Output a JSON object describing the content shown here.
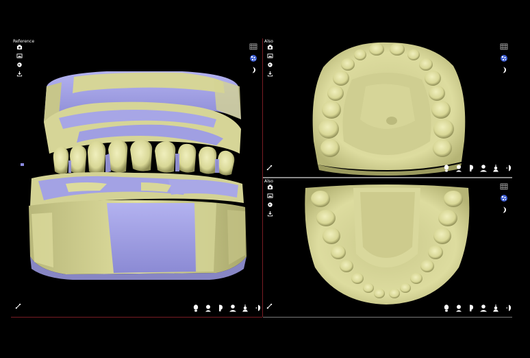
{
  "viewports": {
    "main": {
      "label": "Reference"
    },
    "upper": {
      "label": "Also"
    },
    "lower": {
      "label": "Also"
    }
  },
  "icons": {
    "left_toolbar": [
      "camera-icon",
      "image-icon",
      "globe-icon",
      "download-icon"
    ],
    "right_toolbar": [
      "grid-icon",
      "texture-icon",
      "jaw-icon"
    ],
    "view_bar": [
      "face-front-view-icon",
      "face-left-view-icon",
      "face-right-view-icon",
      "face-back-view-icon",
      "face-bottom-view-icon",
      "face-side-view-icon"
    ],
    "corner": "measure-tool-icon"
  },
  "colors": {
    "background": "#000000",
    "model_gypsum": "#d8d79b",
    "model_shade": "#9c9b60",
    "overlay_violet": "#9e9de4",
    "border_red": "#7a1c24",
    "border_gray": "#8a8a8a",
    "icon_white": "#ffffff",
    "icon_blue": "#5a7fe0"
  }
}
